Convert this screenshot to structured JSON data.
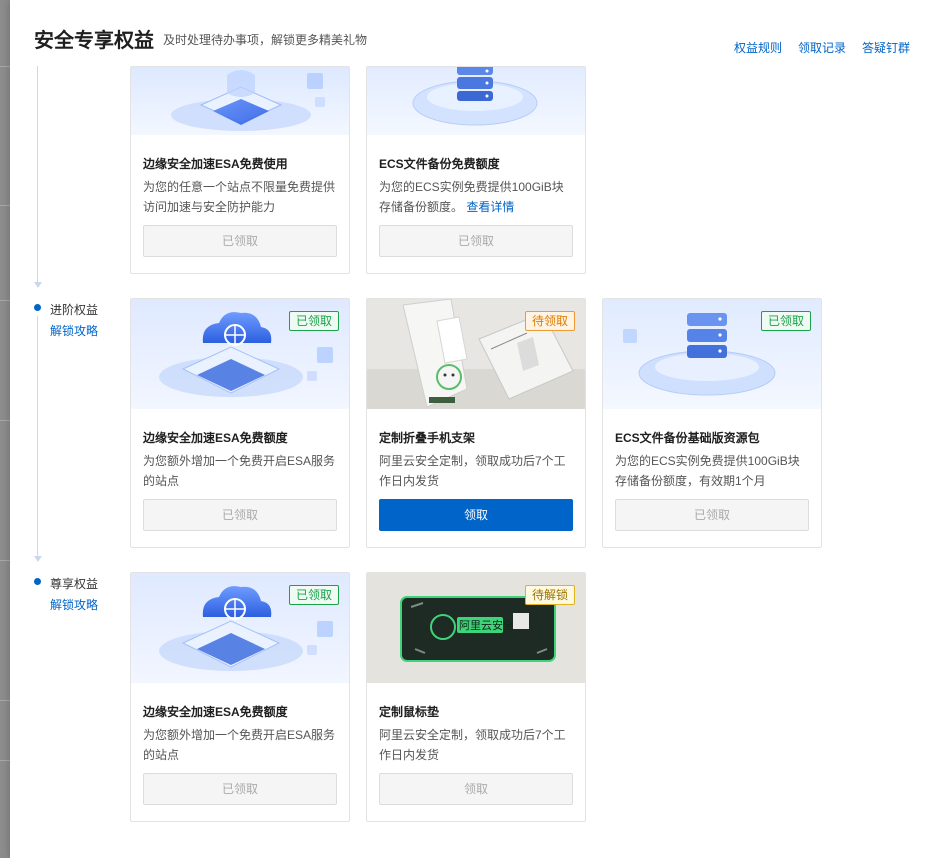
{
  "header": {
    "title": "安全专享权益",
    "subtitle": "及时处理待办事项，解锁更多精美礼物",
    "links": [
      "权益规则",
      "领取记录",
      "答疑钉群"
    ]
  },
  "tiers": [
    {
      "cards": [
        {
          "title": "边缘安全加速ESA免费使用",
          "desc": "为您的任意一个站点不限量免费提供访问加速与安全防护能力",
          "button": "已领取",
          "image": "esa-shield"
        },
        {
          "title": "ECS文件备份免费额度",
          "desc": "为您的ECS实例免费提供100GiB块存储备份额度。",
          "link": "查看详情",
          "button": "已领取",
          "image": "ecs-server"
        }
      ]
    },
    {
      "name": "进阶权益",
      "guide": "解锁攻略",
      "cards": [
        {
          "title": "边缘安全加速ESA免费额度",
          "desc": "为您额外增加一个免费开启ESA服务的站点",
          "badge": "已领取",
          "badge_color": "#1aa34a",
          "button": "已领取",
          "image": "esa-cloud-globe"
        },
        {
          "title": "定制折叠手机支架",
          "desc": "阿里云安全定制，领取成功后7个工作日内发货",
          "badge": "待领取",
          "badge_color": "#f09a37",
          "button": "领取",
          "image": "phone-stand"
        },
        {
          "title": "ECS文件备份基础版资源包",
          "desc": "为您的ECS实例免费提供100GiB块存储备份额度，有效期1个月",
          "badge": "已领取",
          "badge_color": "#1aa34a",
          "button": "已领取",
          "image": "ecs-server"
        }
      ]
    },
    {
      "name": "尊享权益",
      "guide": "解锁攻略",
      "cards": [
        {
          "title": "边缘安全加速ESA免费额度",
          "desc": "为您额外增加一个免费开启ESA服务的站点",
          "badge": "已领取",
          "badge_color": "#1aa34a",
          "button": "已领取",
          "image": "esa-cloud-globe"
        },
        {
          "title": "定制鼠标垫",
          "desc": "阿里云安全定制，领取成功后7个工作日内发货",
          "badge": "待解锁",
          "badge_color": "#e2b320",
          "button": "领取",
          "image": "mouse-pad",
          "mousepad_text": "阿里云安全"
        }
      ]
    }
  ]
}
